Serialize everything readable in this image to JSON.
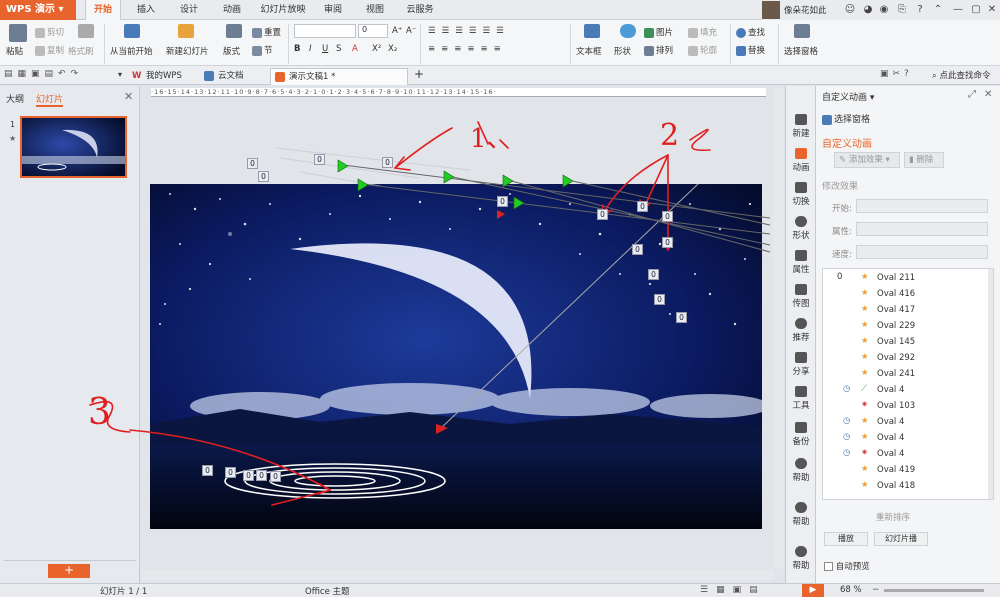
{
  "app": {
    "menu_label": "WPS 演示"
  },
  "ribbon_tabs": [
    "开始",
    "插入",
    "设计",
    "动画",
    "幻灯片放映",
    "审阅",
    "视图",
    "云服务"
  ],
  "user": {
    "name": "像朵花如此"
  },
  "ribbon": {
    "paste": "粘贴",
    "cut": "剪切",
    "copy": "复制",
    "format_painter": "格式刷",
    "from_current": "从当前开始",
    "new_slide": "新建幻灯片",
    "layout": "版式",
    "reset": "重置",
    "section": "节",
    "font_size": "0",
    "textbox": "文本框",
    "shape": "形状",
    "picture": "图片",
    "fill": "填充",
    "arrange": "排列",
    "outline": "轮廓",
    "find": "查找",
    "replace": "替换",
    "selection_pane": "选择窗格"
  },
  "doc_tabs": [
    "我的WPS",
    "云文档",
    "演示文稿1 *"
  ],
  "quick_search": "点此查找命令",
  "left_panel": {
    "tab_outline": "大纲",
    "tab_slides": "幻灯片",
    "slide_number": "1",
    "add_button": "+"
  },
  "sidebar_items": [
    "新建",
    "动画",
    "切换",
    "形状",
    "属性",
    "传图",
    "推荐",
    "分享",
    "工具",
    "备份",
    "帮助",
    "帮助",
    "帮助"
  ],
  "anim_panel": {
    "title": "自定义动画",
    "select_pane": "选择窗格",
    "section_title": "自定义动画",
    "add_effect": "添加效果",
    "delete": "删除",
    "modify_title": "修改效果",
    "start_label": "开始:",
    "prop_label": "属性:",
    "speed_label": "速度:",
    "list_index": "0",
    "items": [
      "Oval 211",
      "Oval 416",
      "Oval 417",
      "Oval 229",
      "Oval 145",
      "Oval 292",
      "Oval 241",
      "Oval 4",
      "Oval 103",
      "Oval 4",
      "Oval 4",
      "Oval 4",
      "Oval 419",
      "Oval 418"
    ],
    "reorder": "重新排序",
    "play": "播放",
    "slideshow": "幻灯片播",
    "autopreview": "自动预览"
  },
  "status": {
    "slide_info": "幻灯片 1 / 1",
    "theme": "Office 主题",
    "zoom": "68 %"
  },
  "annotations": [
    "1、",
    "2",
    "3"
  ],
  "colors": {
    "accent": "#e8642c",
    "slide_bg": "#0b1a4a"
  }
}
